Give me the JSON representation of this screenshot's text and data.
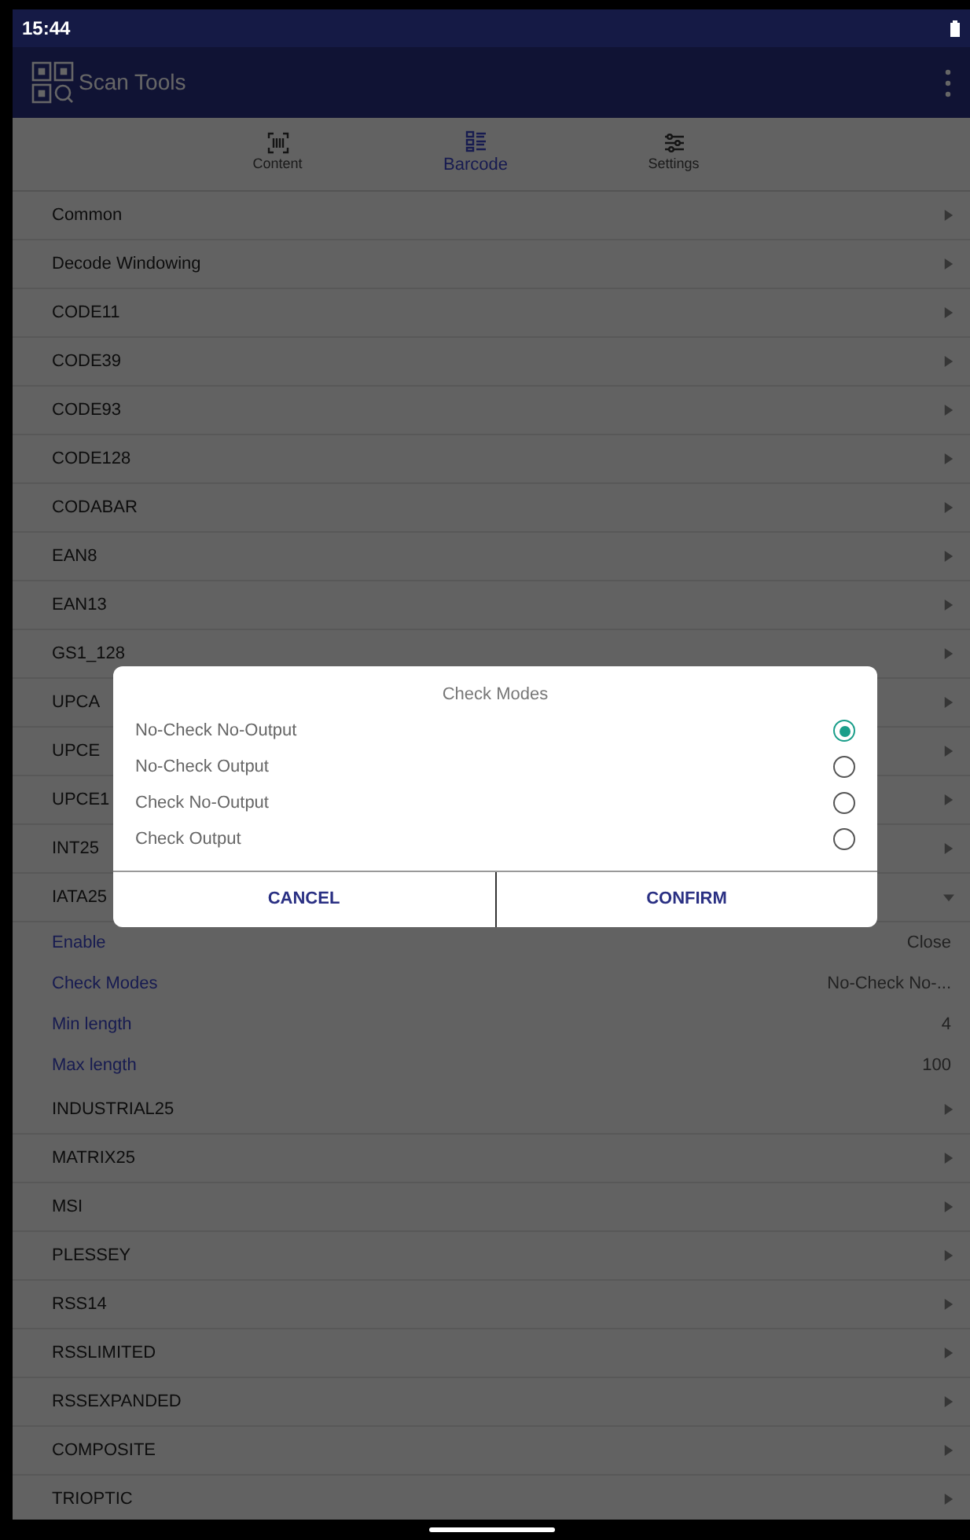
{
  "status_bar": {
    "time": "15:44"
  },
  "app_bar": {
    "title": "Scan Tools"
  },
  "tabs": [
    {
      "label": "Content",
      "selected": false
    },
    {
      "label": "Barcode",
      "selected": true
    },
    {
      "label": "Settings",
      "selected": false
    }
  ],
  "list": [
    {
      "label": "Common",
      "expanded": false
    },
    {
      "label": "Decode Windowing",
      "expanded": false
    },
    {
      "label": "CODE11",
      "expanded": false
    },
    {
      "label": "CODE39",
      "expanded": false
    },
    {
      "label": "CODE93",
      "expanded": false
    },
    {
      "label": "CODE128",
      "expanded": false
    },
    {
      "label": "CODABAR",
      "expanded": false
    },
    {
      "label": "EAN8",
      "expanded": false
    },
    {
      "label": "EAN13",
      "expanded": false
    },
    {
      "label": "GS1_128",
      "expanded": false
    },
    {
      "label": "UPCA",
      "expanded": false
    },
    {
      "label": "UPCE",
      "expanded": false
    },
    {
      "label": "UPCE1",
      "expanded": false
    },
    {
      "label": "INT25",
      "expanded": false
    },
    {
      "label": "IATA25",
      "expanded": true,
      "settings": [
        {
          "label": "Enable",
          "value": "Close"
        },
        {
          "label": "Check Modes",
          "value": "No-Check No-..."
        },
        {
          "label": "Min length",
          "value": "4"
        },
        {
          "label": "Max length",
          "value": "100"
        }
      ]
    },
    {
      "label": "INDUSTRIAL25",
      "expanded": false
    },
    {
      "label": "MATRIX25",
      "expanded": false
    },
    {
      "label": "MSI",
      "expanded": false
    },
    {
      "label": "PLESSEY",
      "expanded": false
    },
    {
      "label": "RSS14",
      "expanded": false
    },
    {
      "label": "RSSLIMITED",
      "expanded": false
    },
    {
      "label": "RSSEXPANDED",
      "expanded": false
    },
    {
      "label": "COMPOSITE",
      "expanded": false
    },
    {
      "label": "TRIOPTIC",
      "expanded": false
    }
  ],
  "dialog": {
    "title": "Check Modes",
    "options": [
      {
        "label": "No-Check No-Output",
        "selected": true
      },
      {
        "label": "No-Check Output",
        "selected": false
      },
      {
        "label": "Check No-Output",
        "selected": false
      },
      {
        "label": "Check Output",
        "selected": false
      }
    ],
    "buttons": [
      "CANCEL",
      "CONFIRM"
    ]
  }
}
